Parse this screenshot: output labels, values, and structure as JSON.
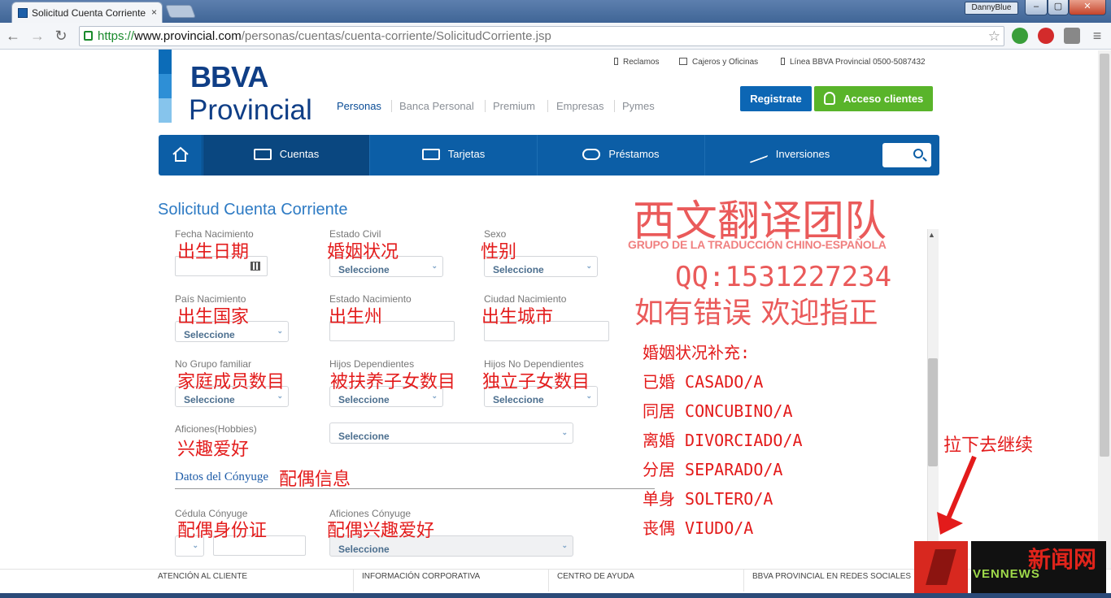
{
  "browser": {
    "tab_title": "Solicitud Cuenta Corriente",
    "tab_close": "×",
    "user": "DannyBlue",
    "window_buttons": [
      "–",
      "▢",
      "✕"
    ],
    "url_scheme": "https://",
    "url_domain": "www.provincial.com",
    "url_path": "/personas/cuentas/cuenta-corriente/SolicitudCorriente.jsp"
  },
  "header": {
    "logo_top": "BBVA",
    "logo_bottom": "Provincial",
    "top_links": [
      "Reclamos",
      "Cajeros y Oficinas",
      "Línea BBVA Provincial 0500-5087432"
    ],
    "segments": [
      "Personas",
      "Banca Personal",
      "Premium",
      "Empresas",
      "Pymes"
    ],
    "register_label": "Registrate",
    "access_label": "Acceso clientes"
  },
  "menu": {
    "items": [
      "Cuentas",
      "Tarjetas",
      "Préstamos",
      "Inversiones"
    ]
  },
  "form": {
    "title": "Solicitud Cuenta Corriente",
    "select_placeholder": "Seleccione",
    "labels": {
      "fecha_nacimiento": "Fecha Nacimiento",
      "estado_civil": "Estado Civil",
      "sexo": "Sexo",
      "pais_nacimiento": "País Nacimiento",
      "estado_nacimiento": "Estado Nacimiento",
      "ciudad_nacimiento": "Ciudad Nacimiento",
      "grupo_familiar": "No Grupo familiar",
      "hijos_dependientes": "Hijos Dependientes",
      "hijos_no_dependientes": "Hijos No Dependientes",
      "aficiones": "Aficiones(Hobbies)",
      "cedula_conyuge": "Cédula Cónyuge",
      "aficiones_conyuge": "Aficiones Cónyuge"
    },
    "section_spouse": "Datos del Cónyuge"
  },
  "annotations": {
    "fecha_nacimiento": "出生日期",
    "estado_civil": "婚姻状况",
    "sexo": "性别",
    "pais_nacimiento": "出生国家",
    "estado_nacimiento": "出生州",
    "ciudad_nacimiento": "出生城市",
    "grupo_familiar": "家庭成员数目",
    "hijos_dependientes": "被扶养子女数目",
    "hijos_no_dependientes": "独立子女数目",
    "aficiones": "兴趣爱好",
    "section_spouse": "配偶信息",
    "cedula_conyuge": "配偶身份证",
    "aficiones_conyuge": "配偶兴趣爱好",
    "team_title": "西文翻译团队",
    "team_subtitle": "GRUPO DE LA TRADUCCIÓN CHINO-ESPAÑOLA",
    "qq": "QQ:1531227234",
    "welcome": "如有错误 欢迎指正",
    "marital_header": "婚姻状况补充:",
    "marital_list": [
      "已婚 CASADO/A",
      "同居 CONCUBINO/A",
      "离婚 DIVORCIADO/A",
      "分居 SEPARADO/A",
      "单身 SOLTERO/A",
      "丧偶 VIUDO/A"
    ],
    "scroll_hint": "拉下去继续"
  },
  "footer": {
    "cols": [
      "ATENCIÓN AL CLIENTE",
      "INFORMACIÓN CORPORATIVA",
      "CENTRO DE AYUDA",
      "BBVA PROVINCIAL EN REDES SOCIALES"
    ]
  },
  "watermark_logo": {
    "line1": "新闻网",
    "line2": "VENNEWS"
  },
  "colors": {
    "brand_blue": "#0c5ea6",
    "accent_green": "#59b42a",
    "annotation_red": "#e31b1b"
  }
}
